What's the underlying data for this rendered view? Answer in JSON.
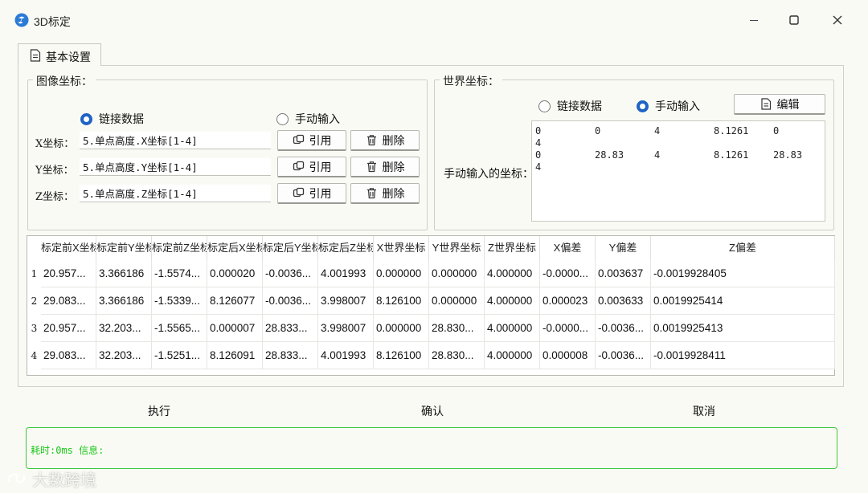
{
  "window": {
    "title": "3D标定"
  },
  "tab": {
    "label": "基本设置"
  },
  "image_coords": {
    "group_title": "图像坐标：",
    "radio_link": "链接数据",
    "radio_manual": "手动输入",
    "selected": "link",
    "rows": [
      {
        "label": "X坐标：",
        "value": "5.单点高度.X坐标[1-4]"
      },
      {
        "label": "Y坐标：",
        "value": "5.单点高度.Y坐标[1-4]"
      },
      {
        "label": "Z坐标：",
        "value": "5.单点高度.Z坐标[1-4]"
      }
    ],
    "ref_label": "引用",
    "delete_label": "删除"
  },
  "world_coords": {
    "group_title": "世界坐标：",
    "radio_link": "链接数据",
    "radio_manual": "手动输入",
    "selected": "manual",
    "edit_label": "编辑",
    "manual_label": "手动输入的坐标：",
    "manual_lines": [
      [
        "0",
        "0",
        "4",
        "8.1261",
        "0"
      ],
      [
        "4"
      ],
      [
        "0",
        "28.83",
        "4",
        "8.1261",
        "28.83"
      ],
      [
        "4"
      ]
    ]
  },
  "table": {
    "headers": [
      "标定前X坐标",
      "标定前Y坐标",
      "标定前Z坐标",
      "标定后X坐标",
      "标定后Y坐标",
      "标定后Z坐标",
      "X世界坐标",
      "Y世界坐标",
      "Z世界坐标",
      "X偏差",
      "Y偏差",
      "Z偏差"
    ],
    "rows": [
      {
        "index": "1",
        "cells": [
          "20.957...",
          "3.366186",
          "-1.5574...",
          "0.000020",
          "-0.0036...",
          "4.001993",
          "0.000000",
          "0.000000",
          "4.000000",
          "-0.0000...",
          "0.003637",
          "-0.0019928405"
        ]
      },
      {
        "index": "2",
        "cells": [
          "29.083...",
          "3.366186",
          "-1.5339...",
          "8.126077",
          "-0.0036...",
          "3.998007",
          "8.126100",
          "0.000000",
          "4.000000",
          "0.000023",
          "0.003633",
          "0.0019925414"
        ]
      },
      {
        "index": "3",
        "cells": [
          "20.957...",
          "32.203...",
          "-1.5565...",
          "0.000007",
          "28.833...",
          "3.998007",
          "0.000000",
          "28.830...",
          "4.000000",
          "-0.0000...",
          "-0.0036...",
          "0.0019925413"
        ]
      },
      {
        "index": "4",
        "cells": [
          "29.083...",
          "32.203...",
          "-1.5251...",
          "8.126091",
          "28.833...",
          "4.001993",
          "8.126100",
          "28.830...",
          "4.000000",
          "0.000008",
          "-0.0036...",
          "-0.0019928411"
        ]
      }
    ]
  },
  "actions": {
    "run": "执行",
    "confirm": "确认",
    "cancel": "取消"
  },
  "status": {
    "text": "耗时:0ms 信息:"
  },
  "watermark": {
    "text": "大数跨境"
  },
  "colors": {
    "accent": "#1f63c6",
    "status_green": "#17c817",
    "status_border": "#3ec83e"
  }
}
